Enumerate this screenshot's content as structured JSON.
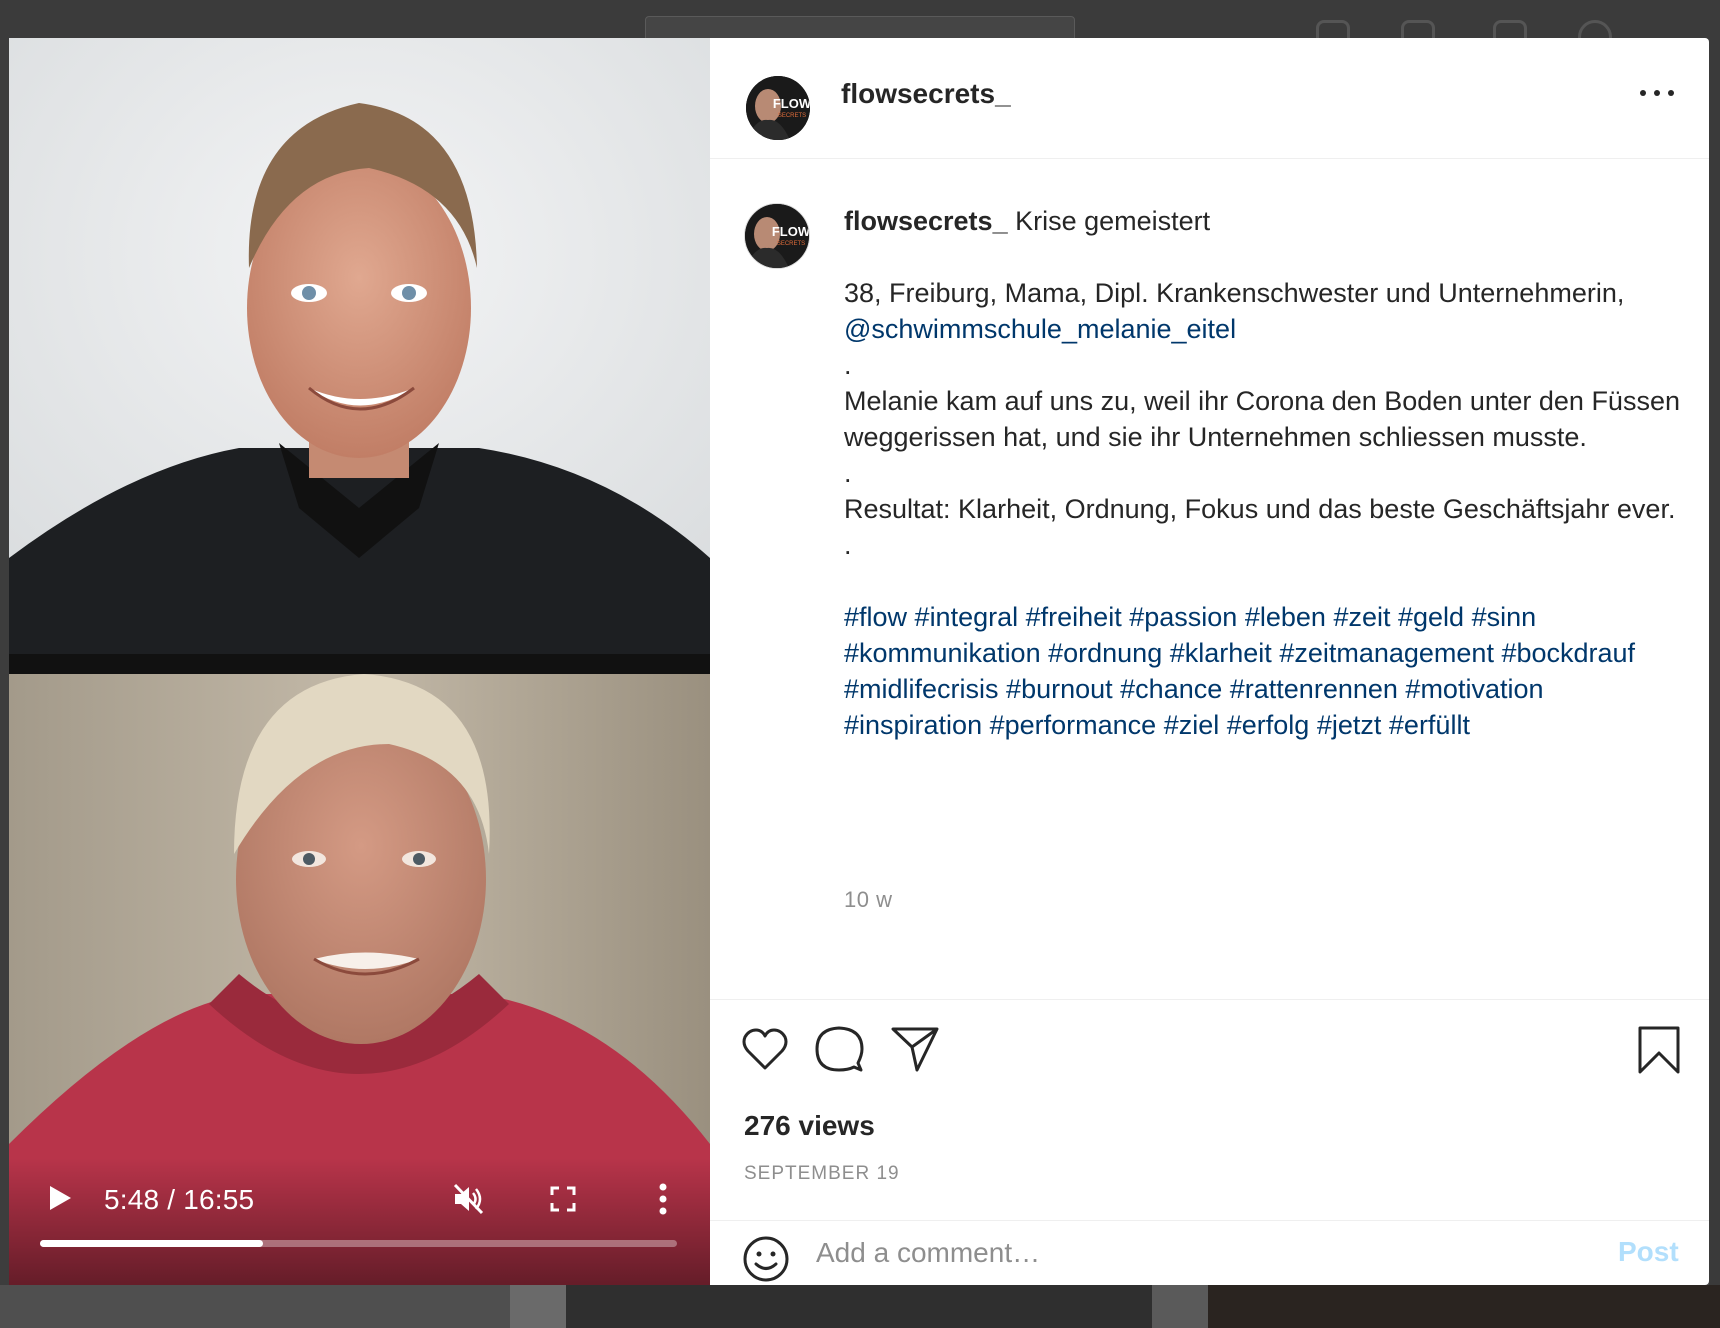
{
  "post": {
    "username": "flowsecrets_",
    "avatar_text": "FLOW",
    "avatar_subtext": "SECRETS",
    "caption": {
      "username": "flowsecrets_",
      "title": "Krise gemeistert",
      "line1": "38, Freiburg, Mama, Dipl. Krankenschwester und Unternehmerin,",
      "mention": "@schwimmschule_melanie_eitel",
      "dot1": ".",
      "para1": "Melanie kam auf uns zu, weil ihr Corona den Boden unter den Füssen weggerissen hat, und sie ihr Unternehmen schliessen musste.",
      "dot2": ".",
      "para2": "Resultat: Klarheit, Ordnung, Fokus und das beste Geschäftsjahr ever.",
      "dot3": ".",
      "hashtags": [
        "#flow",
        "#integral",
        "#freiheit",
        "#passion",
        "#leben",
        "#zeit",
        "#geld",
        "#sinn",
        "#kommunikation",
        "#ordnung",
        "#klarheit",
        "#zeitmanagement",
        "#bockdrauf",
        "#midlifecrisis",
        "#burnout",
        "#chance",
        "#rattenrennen",
        "#motivation",
        "#inspiration",
        "#performance",
        "#ziel",
        "#erfolg",
        "#jetzt",
        "#erfüllt"
      ],
      "time_ago": "10 w"
    },
    "views": "276 views",
    "date": "SEPTEMBER 19",
    "comment_placeholder": "Add a comment…",
    "post_button": "Post"
  },
  "video": {
    "time": "5:48 / 16:55",
    "progress_fraction": 0.35,
    "muted": true
  },
  "icons": {
    "like": "heart-icon",
    "comment": "comment-icon",
    "share": "share-icon",
    "save": "bookmark-icon",
    "emoji": "emoji-icon",
    "play": "play-icon",
    "mute": "muted-speaker-icon",
    "fullscreen": "fullscreen-icon",
    "menu": "vertical-dots-icon",
    "more": "more-options-icon"
  },
  "colors": {
    "link": "#00376b",
    "post_disabled": "#b2dffc",
    "text": "#262626",
    "muted": "#8e8e8e"
  }
}
